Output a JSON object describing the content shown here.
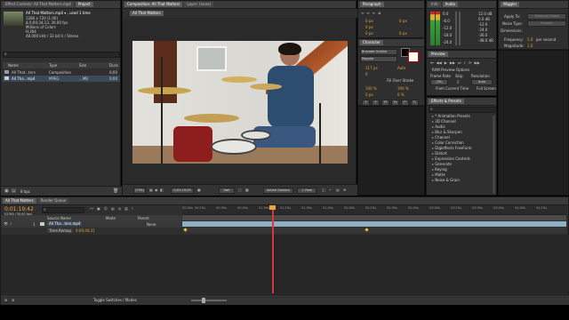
{
  "project": {
    "tabs": [
      "Effect Controls: All That Matters.mp4",
      "Project"
    ],
    "file_name": "All That Matters.mp4 ▾ , used 1 time",
    "info_lines": [
      "1280 x 720 (1.00)",
      "Δ 0;00;34;13, 30.00 fps",
      "Millions of Colors",
      "H.264",
      "48.000 kHz / 32 bit U / Stereo"
    ],
    "search_placeholder": "",
    "columns": [
      "Name",
      "Type",
      "Size",
      "Dura"
    ],
    "items": [
      {
        "name": "All That...ters",
        "type": "Composition",
        "size": "",
        "duration": "0;00"
      },
      {
        "name": "All Tha...mp4",
        "type": "MPEG",
        "size": "...MB",
        "duration": "0;00"
      }
    ],
    "footer_label": "8 bpc"
  },
  "composition": {
    "tabs": [
      "Composition: All That Matters",
      "Layer: (none)"
    ],
    "sub_tab": "All That Matters",
    "zoom": "(73%)",
    "timecode": "0;01:19;29",
    "resolution": "Half",
    "camera": "Active Camera",
    "view": "1 View"
  },
  "paragraph": {
    "title": "Paragraph",
    "fields": [
      "0 px",
      "0 px",
      "0 px",
      "0 px",
      "0 px"
    ]
  },
  "audio": {
    "tabs": [
      "Info",
      "Audio"
    ],
    "left_levels": [
      "0.0",
      "-6.0",
      "-12.0",
      "-18.0",
      "-24.0"
    ],
    "right_levels": [
      "12.0 dB",
      "0.0 dB",
      "-12.0",
      "-24.0",
      "-36.0",
      "-48.0 dB"
    ]
  },
  "wiggler": {
    "title": "Wiggler",
    "apply_to_label": "Apply To:",
    "apply_to_value": "Temporal Graph",
    "noise_type_label": "Noise Type:",
    "noise_type_value": "Smooth",
    "dimensions_label": "Dimensions:",
    "frequency_label": "Frequency:",
    "frequency_value": "5.0",
    "frequency_unit": "per second",
    "magnitude_label": "Magnitude:",
    "magnitude_value": "1.0"
  },
  "character": {
    "title": "Character",
    "font": "Bracode Outline",
    "style": "Regular",
    "size": "117 px",
    "leading": "Auto",
    "tracking": "0",
    "fill_label": "Fill Over Stroke",
    "scale_v": "100 %",
    "scale_h": "100 %",
    "baseline": "0 px",
    "tsume": "0 %"
  },
  "preview": {
    "title": "Preview",
    "ram_options": "RAM Preview Options",
    "frame_rate_label": "Frame Rate",
    "skip_label": "Skip",
    "resolution_label": "Resolution",
    "frame_rate_value": "(30)",
    "skip_value": "0",
    "resolution_value": "Auto",
    "from_current": "From Current Time",
    "full_screen": "Full Screen"
  },
  "effects": {
    "title": "Effects & Presets",
    "items": [
      "* Animation Presets",
      "3D Channel",
      "Audio",
      "Blur & Sharpen",
      "Channel",
      "Color Correction",
      "Digieffects FreeForm",
      "Distort",
      "Expression Controls",
      "Generate",
      "Keying",
      "Matte",
      "Noise & Grain"
    ]
  },
  "timeline": {
    "tabs": [
      "All That Matters",
      "Render Queue"
    ],
    "timecode": "0;01:19;42",
    "frame_info": "02392 (30.00 fps)",
    "columns": [
      "Source Name",
      "Mode",
      "Parent"
    ],
    "layers": [
      {
        "num": "1",
        "name": "All Tha...ters.mp4",
        "parent": "None"
      },
      {
        "num": "",
        "name": "Time Remap",
        "parent": "0;00;44;31"
      }
    ],
    "ruler_ticks": [
      "00:00s",
      "00:15s",
      "00:30s",
      "00:45s",
      "01:00s",
      "01:15s",
      "01:30s",
      "01:45s",
      "02:00s",
      "02:15s",
      "02:30s",
      "02:45s",
      "03:00s",
      "03:15s",
      "03:30s",
      "03:45s",
      "04:00s",
      "04:15s"
    ],
    "toggle_label": "Toggle Switches / Modes"
  },
  "colors": {
    "accent_orange": "#e9a43a",
    "track_blue": "#8fb0c0",
    "playhead_red": "#d43a3a"
  }
}
